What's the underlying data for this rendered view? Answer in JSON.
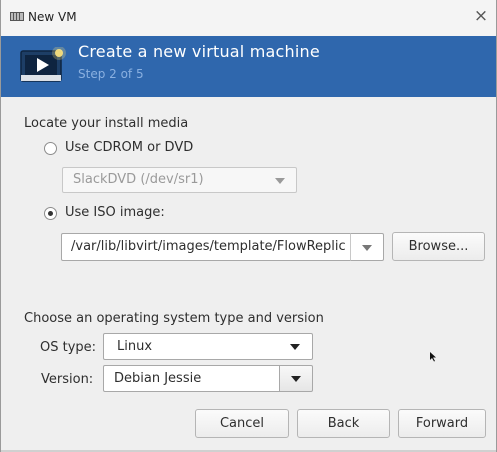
{
  "window": {
    "title": "New VM",
    "close_label": "×"
  },
  "banner": {
    "title": "Create a new virtual machine",
    "step": "Step 2 of 5"
  },
  "media": {
    "heading": "Locate your install media",
    "cdrom_label": "Use CDROM or DVD",
    "cdrom_device": "SlackDVD (/dev/sr1)",
    "iso_label": "Use ISO image:",
    "iso_path": "/var/lib/libvirt/images/template/FlowReplic",
    "browse_label": "Browse...",
    "selected_option": "iso"
  },
  "os": {
    "heading": "Choose an operating system type and version",
    "type_label": "OS type:",
    "type_value": "Linux",
    "version_label": "Version:",
    "version_value": "Debian Jessie"
  },
  "buttons": {
    "cancel": "Cancel",
    "back": "Back",
    "forward": "Forward"
  },
  "colors": {
    "banner": "#2f67ad",
    "banner_sub": "#8ab0e0"
  },
  "icons": [
    "app-icon",
    "close-icon",
    "monitor-play-icon",
    "chevron-down-icon",
    "mouse-pointer-icon"
  ]
}
